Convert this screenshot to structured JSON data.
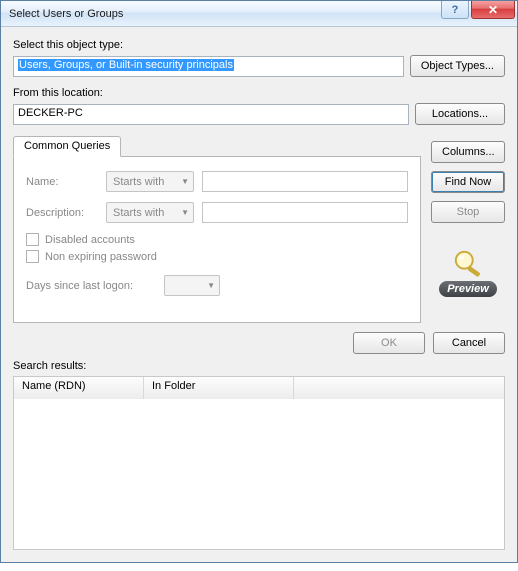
{
  "title": "Select Users or Groups",
  "labels": {
    "objectType": "Select this object type:",
    "location": "From this location:",
    "searchResults": "Search results:"
  },
  "fields": {
    "objectTypeValue": "Users, Groups, or Built-in security principals",
    "locationValue": "DECKER-PC"
  },
  "buttons": {
    "objectTypes": "Object Types...",
    "locations": "Locations...",
    "columns": "Columns...",
    "findNow": "Find Now",
    "stop": "Stop",
    "ok": "OK",
    "cancel": "Cancel",
    "preview": "Preview"
  },
  "tabs": {
    "commonQueries": "Common Queries"
  },
  "queries": {
    "nameLabel": "Name:",
    "descLabel": "Description:",
    "startsWith": "Starts with",
    "disabled": "Disabled accounts",
    "nonExpiring": "Non expiring password",
    "daysSince": "Days since last logon:"
  },
  "columns": {
    "rdn": "Name (RDN)",
    "inFolder": "In Folder"
  }
}
